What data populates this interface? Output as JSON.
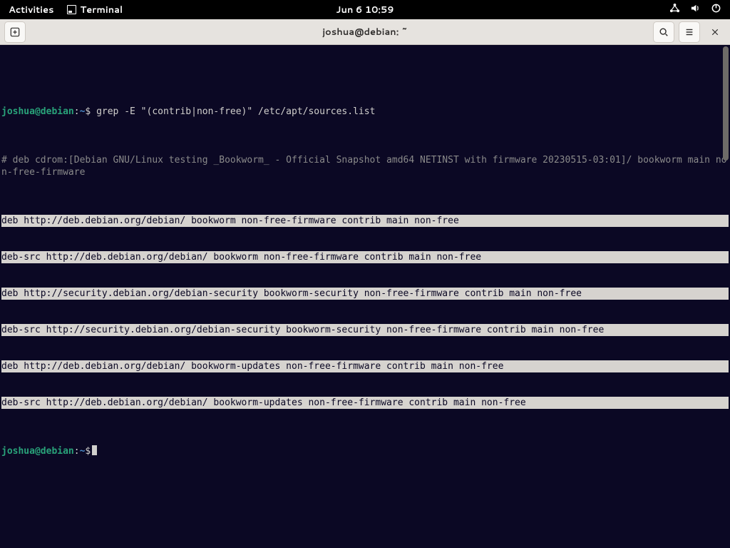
{
  "topbar": {
    "activities": "Activities",
    "app_name": "Terminal",
    "clock": "Jun 6  10:59"
  },
  "window": {
    "title": "joshua@debian: ~"
  },
  "prompt": {
    "user_host": "joshua@debian",
    "colon": ":",
    "path": "~",
    "symbol": "$"
  },
  "term": {
    "cmd1": "grep -E \"(contrib|non-free)\" /etc/apt/sources.list",
    "out_comment": "# deb cdrom:[Debian GNU/Linux testing _Bookworm_ - Official Snapshot amd64 NETINST with firmware 20230515-03:01]/ bookworm main non-free-firmware",
    "out_lines": [
      "deb http://deb.debian.org/debian/ bookworm non-free-firmware contrib main non-free",
      "deb-src http://deb.debian.org/debian/ bookworm non-free-firmware contrib main non-free",
      "deb http://security.debian.org/debian-security bookworm-security non-free-firmware contrib main non-free",
      "deb-src http://security.debian.org/debian-security bookworm-security non-free-firmware contrib main non-free",
      "deb http://deb.debian.org/debian/ bookworm-updates non-free-firmware contrib main non-free",
      "deb-src http://deb.debian.org/debian/ bookworm-updates non-free-firmware contrib main non-free"
    ]
  }
}
